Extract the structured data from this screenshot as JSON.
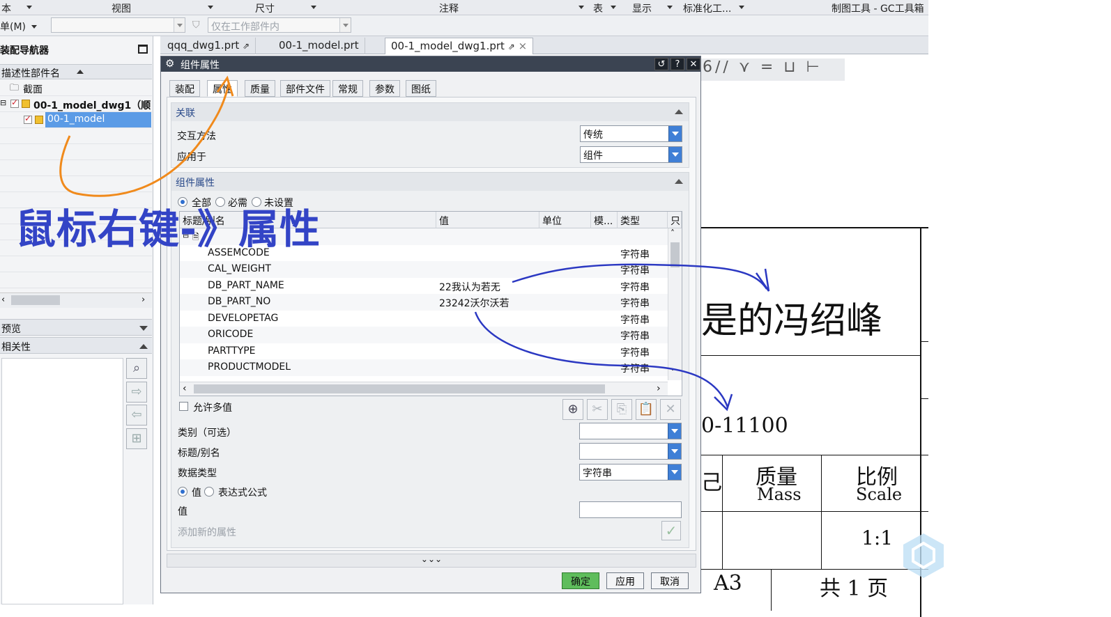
{
  "ribbon": {
    "items": [
      "本",
      "视图",
      "尺寸",
      "注释",
      "表",
      "显示",
      "标准化工...",
      "制图工具 - GC工具箱"
    ]
  },
  "toolbar": {
    "menu_label": "单(M)",
    "filter_placeholder": "仅在工作部件内"
  },
  "navigator": {
    "title": "装配导航器",
    "column_header": "描述性部件名",
    "tree": [
      "截面",
      "00-1_model_dwg1（顺",
      "00-1_model"
    ],
    "preview_label": "预览",
    "dependency_label": "相关性"
  },
  "file_tabs": [
    "qqq_dwg1.prt",
    "00-1_model.prt",
    "00-1_model_dwg1.prt"
  ],
  "dialog": {
    "title": "组件属性",
    "tabs": [
      "装配",
      "属性",
      "质量",
      "部件文件",
      "常规",
      "参数",
      "图纸"
    ],
    "active_tab": "属性",
    "assoc": {
      "header": "关联",
      "interaction_label": "交互方法",
      "interaction_value": "传统",
      "apply_label": "应用于",
      "apply_value": "组件"
    },
    "attrs": {
      "header": "组件属性",
      "filter_options": [
        "全部",
        "必需",
        "未设置"
      ],
      "columns": [
        "标题/别名",
        "值",
        "单位",
        "模...",
        "类型",
        "只"
      ],
      "group_row": "",
      "rows": [
        {
          "title": "ASSEMCODE",
          "value": "",
          "type": "字符串"
        },
        {
          "title": "CAL_WEIGHT",
          "value": "",
          "type": "字符串"
        },
        {
          "title": "DB_PART_NAME",
          "value": "22我认为若无",
          "type": "字符串"
        },
        {
          "title": "DB_PART_NO",
          "value": "23242沃尔沃若",
          "type": "字符串"
        },
        {
          "title": "DEVELOPETAG",
          "value": "",
          "type": "字符串"
        },
        {
          "title": "ORICODE",
          "value": "",
          "type": "字符串"
        },
        {
          "title": "PARTTYPE",
          "value": "",
          "type": "字符串"
        },
        {
          "title": "PRODUCTMODEL",
          "value": "",
          "type": "字符串"
        }
      ],
      "allow_multi_label": "允许多值",
      "category_label": "类别（可选）",
      "title_label": "标题/别名",
      "datatype_label": "数据类型",
      "datatype_value": "字符串",
      "value_option": "值",
      "expr_option": "表达式公式",
      "value_label": "值",
      "add_new_label": "添加新的属性"
    },
    "ok": "确定",
    "apply": "应用",
    "cancel": "取消"
  },
  "drawing": {
    "title_text": "是的冯绍峰",
    "code_text": "0-11100",
    "mass_cn": "质量",
    "mass_en": "Mass",
    "scale_cn": "比例",
    "scale_en": "Scale",
    "scale_value": "1:1",
    "sheet_size": "A3",
    "page_text": "共 1 页",
    "side_char": "己"
  },
  "annotation": "鼠标右键-》属性"
}
